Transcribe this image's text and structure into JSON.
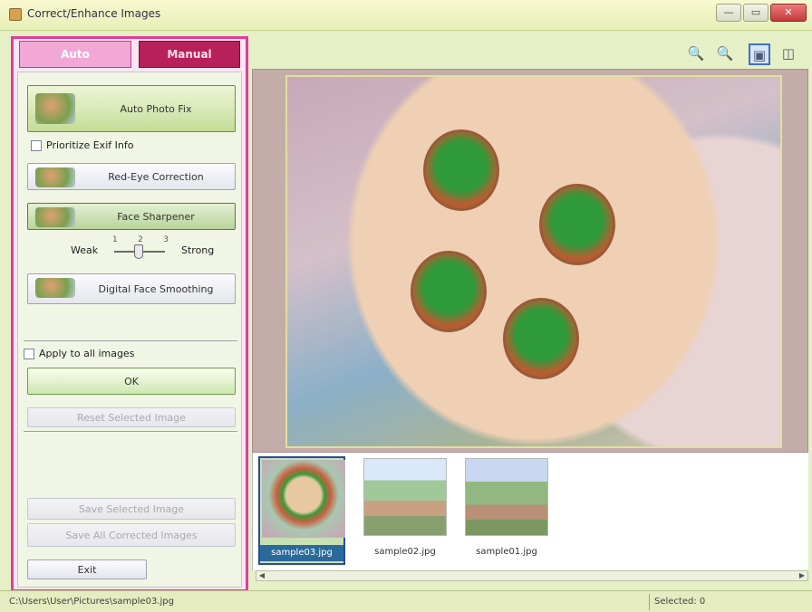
{
  "window": {
    "title": "Correct/Enhance Images",
    "buttons": {
      "minimize": "—",
      "maximize": "▭",
      "close": "✕"
    }
  },
  "tabs": [
    {
      "label": "Auto",
      "active": true
    },
    {
      "label": "Manual",
      "active": false
    }
  ],
  "auto_panel": {
    "auto_photo_fix": "Auto Photo Fix",
    "prioritize_exif": "Prioritize Exif Info",
    "red_eye": "Red-Eye Correction",
    "face_sharpener": "Face Sharpener",
    "strength": {
      "weak": "Weak",
      "strong": "Strong",
      "ticks": [
        "1",
        "2",
        "3"
      ],
      "level": 2
    },
    "digital_face_smoothing": "Digital Face Smoothing",
    "apply_all": "Apply to all images",
    "ok": "OK",
    "reset": "Reset Selected Image",
    "save_selected": "Save Selected Image",
    "save_all": "Save All Corrected Images",
    "exit": "Exit"
  },
  "toolbar": {
    "zoom_in": "🔍",
    "zoom_out": "🔍",
    "view_whole": "▣",
    "compare": "◫"
  },
  "thumbnails": [
    {
      "caption": "sample03.jpg",
      "selected": true
    },
    {
      "caption": "sample02.jpg",
      "selected": false
    },
    {
      "caption": "sample01.jpg",
      "selected": false
    }
  ],
  "status": {
    "path": "C:\\Users\\User\\Pictures\\sample03.jpg",
    "selected": "Selected: 0"
  },
  "colors": {
    "accent": "#e33c9a",
    "manual_tab": "#b8205a",
    "panel_bg": "#e6f0c6"
  }
}
